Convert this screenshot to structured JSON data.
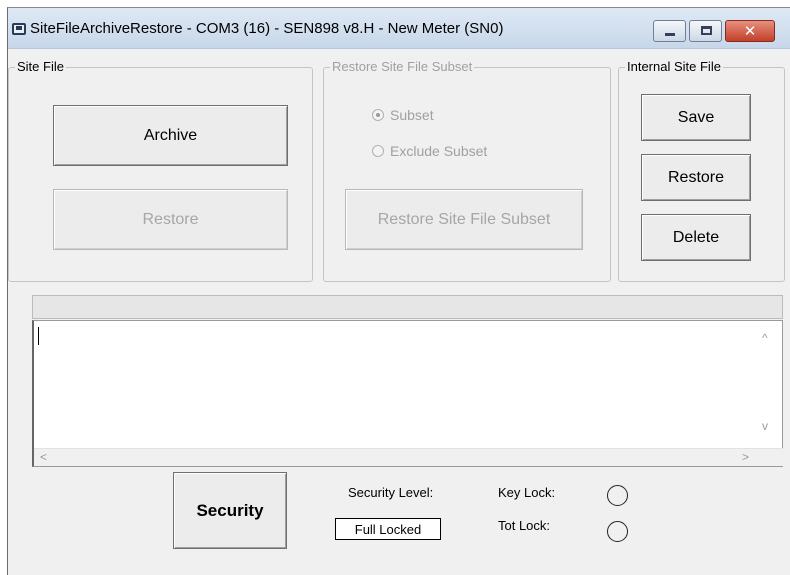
{
  "window": {
    "title": "SiteFileArchiveRestore - COM3 (16) - SEN898 v8.H - New Meter (SN0)",
    "controls": {
      "close_glyph": "✕"
    }
  },
  "site_file": {
    "group_label": "Site File",
    "archive_label": "Archive",
    "restore_label": "Restore"
  },
  "subset": {
    "group_label": "Restore Site File Subset",
    "options": [
      {
        "label": "Subset",
        "checked": true
      },
      {
        "label": "Exclude Subset",
        "checked": false
      }
    ],
    "restore_subset_label": "Restore Site File Subset"
  },
  "internal": {
    "group_label": "Internal Site File",
    "save_label": "Save",
    "restore_label": "Restore",
    "delete_label": "Delete"
  },
  "log": {
    "scroll_up": "^",
    "scroll_down": "v",
    "scroll_left": "<",
    "scroll_right": ">"
  },
  "footer": {
    "security_label": "Security",
    "security_level_label": "Security Level:",
    "security_level_value": "Full Locked",
    "key_lock_label": "Key Lock:",
    "tot_lock_label": "Tot Lock:"
  },
  "colors": {
    "window_bg": "#f0f0f0",
    "title_bg": "#c7d7ea",
    "close_button": "#c2402a",
    "disabled_text": "#a0a0a0"
  }
}
